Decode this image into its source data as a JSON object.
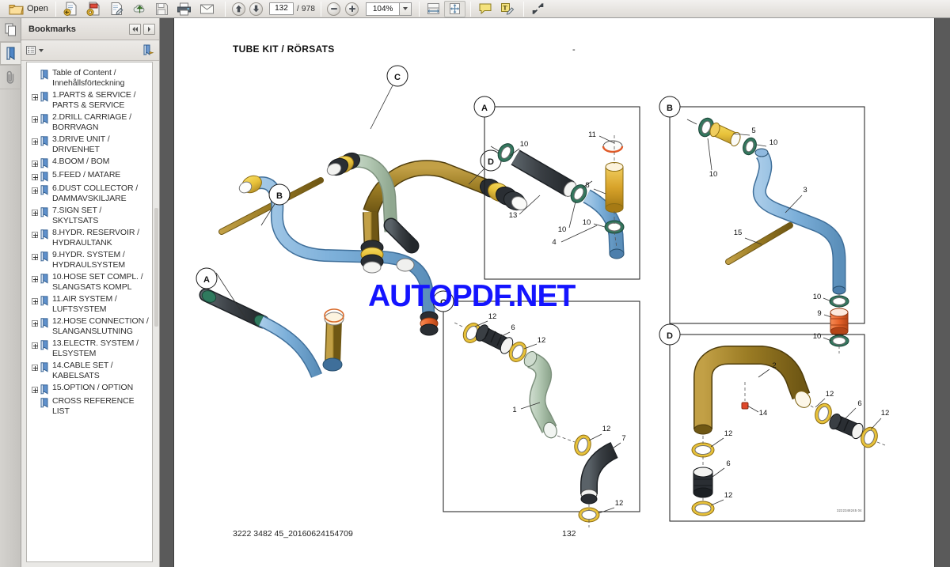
{
  "toolbar": {
    "open_label": "Open",
    "buttons": [
      {
        "name": "open-folder-icon",
        "label": "Open"
      },
      {
        "name": "create-pdf-icon",
        "label": ""
      },
      {
        "name": "combine-files-icon",
        "label": ""
      },
      {
        "name": "edit-pdf-icon",
        "label": ""
      },
      {
        "name": "upload-cloud-icon",
        "label": ""
      },
      {
        "name": "save-icon",
        "label": ""
      },
      {
        "name": "print-icon",
        "label": ""
      },
      {
        "name": "email-icon",
        "label": ""
      }
    ],
    "page_nav": {
      "previous_page_icon": "up-arrow-icon",
      "next_page_icon": "down-arrow-icon",
      "current_page": "132",
      "total_pages": "/ 978"
    },
    "zoom": {
      "zoom_out_icon": "minus-icon",
      "zoom_in_icon": "plus-icon",
      "level": "104%",
      "dropdown_icon": "chevron-down-icon"
    },
    "view_buttons": [
      {
        "name": "fit-width-icon"
      },
      {
        "name": "fit-page-icon",
        "pressed": true
      }
    ],
    "comment_buttons": [
      {
        "name": "sticky-note-icon"
      },
      {
        "name": "highlight-text-icon"
      }
    ],
    "fullscreen_icon": "expand-arrows-icon"
  },
  "rail": {
    "items": [
      {
        "name": "page-thumbnails-icon",
        "active": false
      },
      {
        "name": "bookmarks-icon",
        "active": true
      },
      {
        "name": "attachments-paperclip-icon",
        "active": false
      }
    ]
  },
  "bookmarks_panel": {
    "title": "Bookmarks",
    "collapse_icon": "collapse-left-icon",
    "expand_icon": "expand-right-icon",
    "options_icon": "options-list-icon",
    "options_caret": "caret-down-icon",
    "new_bookmark_icon": "new-bookmark-icon",
    "items": [
      {
        "label": "Table of Content / Innehållsförteckning",
        "expandable": false
      },
      {
        "label": "1.PARTS & SERVICE / PARTS & SERVICE",
        "expandable": true
      },
      {
        "label": "2.DRILL CARRIAGE / BORRVAGN",
        "expandable": true
      },
      {
        "label": "3.DRIVE UNIT / DRIVENHET",
        "expandable": true
      },
      {
        "label": "4.BOOM / BOM",
        "expandable": true
      },
      {
        "label": "5.FEED / MATARE",
        "expandable": true
      },
      {
        "label": "6.DUST COLLECTOR / DAMMAVSKILJARE",
        "expandable": true
      },
      {
        "label": "7.SIGN SET / SKYLTSATS",
        "expandable": true
      },
      {
        "label": "8.HYDR. RESERVOIR / HYDRAULTANK",
        "expandable": true
      },
      {
        "label": "9.HYDR. SYSTEM / HYDRAULSYSTEM",
        "expandable": true
      },
      {
        "label": "10.HOSE SET COMPL. / SLANGSATS KOMPL",
        "expandable": true
      },
      {
        "label": "11.AIR SYSTEM / LUFTSYSTEM",
        "expandable": true
      },
      {
        "label": "12.HOSE CONNECTION / SLANGANSLUTNING",
        "expandable": true
      },
      {
        "label": "13.ELECTR. SYSTEM / ELSYSTEM",
        "expandable": true
      },
      {
        "label": "14.CABLE SET / KABELSATS",
        "expandable": true
      },
      {
        "label": "15.OPTION / OPTION",
        "expandable": true
      },
      {
        "label": "CROSS REFERENCE LIST",
        "expandable": false
      }
    ]
  },
  "document": {
    "title": "TUBE KIT / RÖRSATS",
    "header_dash": "-",
    "footer_left": "3222 3482 45_20160624154709",
    "footer_page": "132",
    "drawing_number": "3222348245 04",
    "watermark": "AUTOPDF.NET",
    "main_assembly": {
      "balloons": [
        "A",
        "B",
        "C",
        "D"
      ]
    },
    "detail_panels": [
      {
        "id": "A",
        "callouts": [
          "10",
          "13",
          "10",
          "4",
          "11",
          "8",
          "10"
        ]
      },
      {
        "id": "B",
        "callouts": [
          "10",
          "5",
          "10",
          "3",
          "15",
          "10",
          "9",
          "10"
        ]
      },
      {
        "id": "C",
        "callouts": [
          "12",
          "6",
          "12",
          "1",
          "12",
          "7",
          "12"
        ]
      },
      {
        "id": "D",
        "callouts": [
          "2",
          "14",
          "12",
          "6",
          "12",
          "12",
          "6",
          "12"
        ]
      }
    ],
    "colors": {
      "tube_blue": "#7db0da",
      "tube_green": "#b4c9b4",
      "tube_brown": "#9b7c24",
      "tube_black": "#3a3f44",
      "clamp_yellow": "#e8c23a",
      "seal_green": "#3d7a63",
      "bellows_orange": "#e8642a",
      "sleeve_gold": "#d8a32a"
    }
  }
}
